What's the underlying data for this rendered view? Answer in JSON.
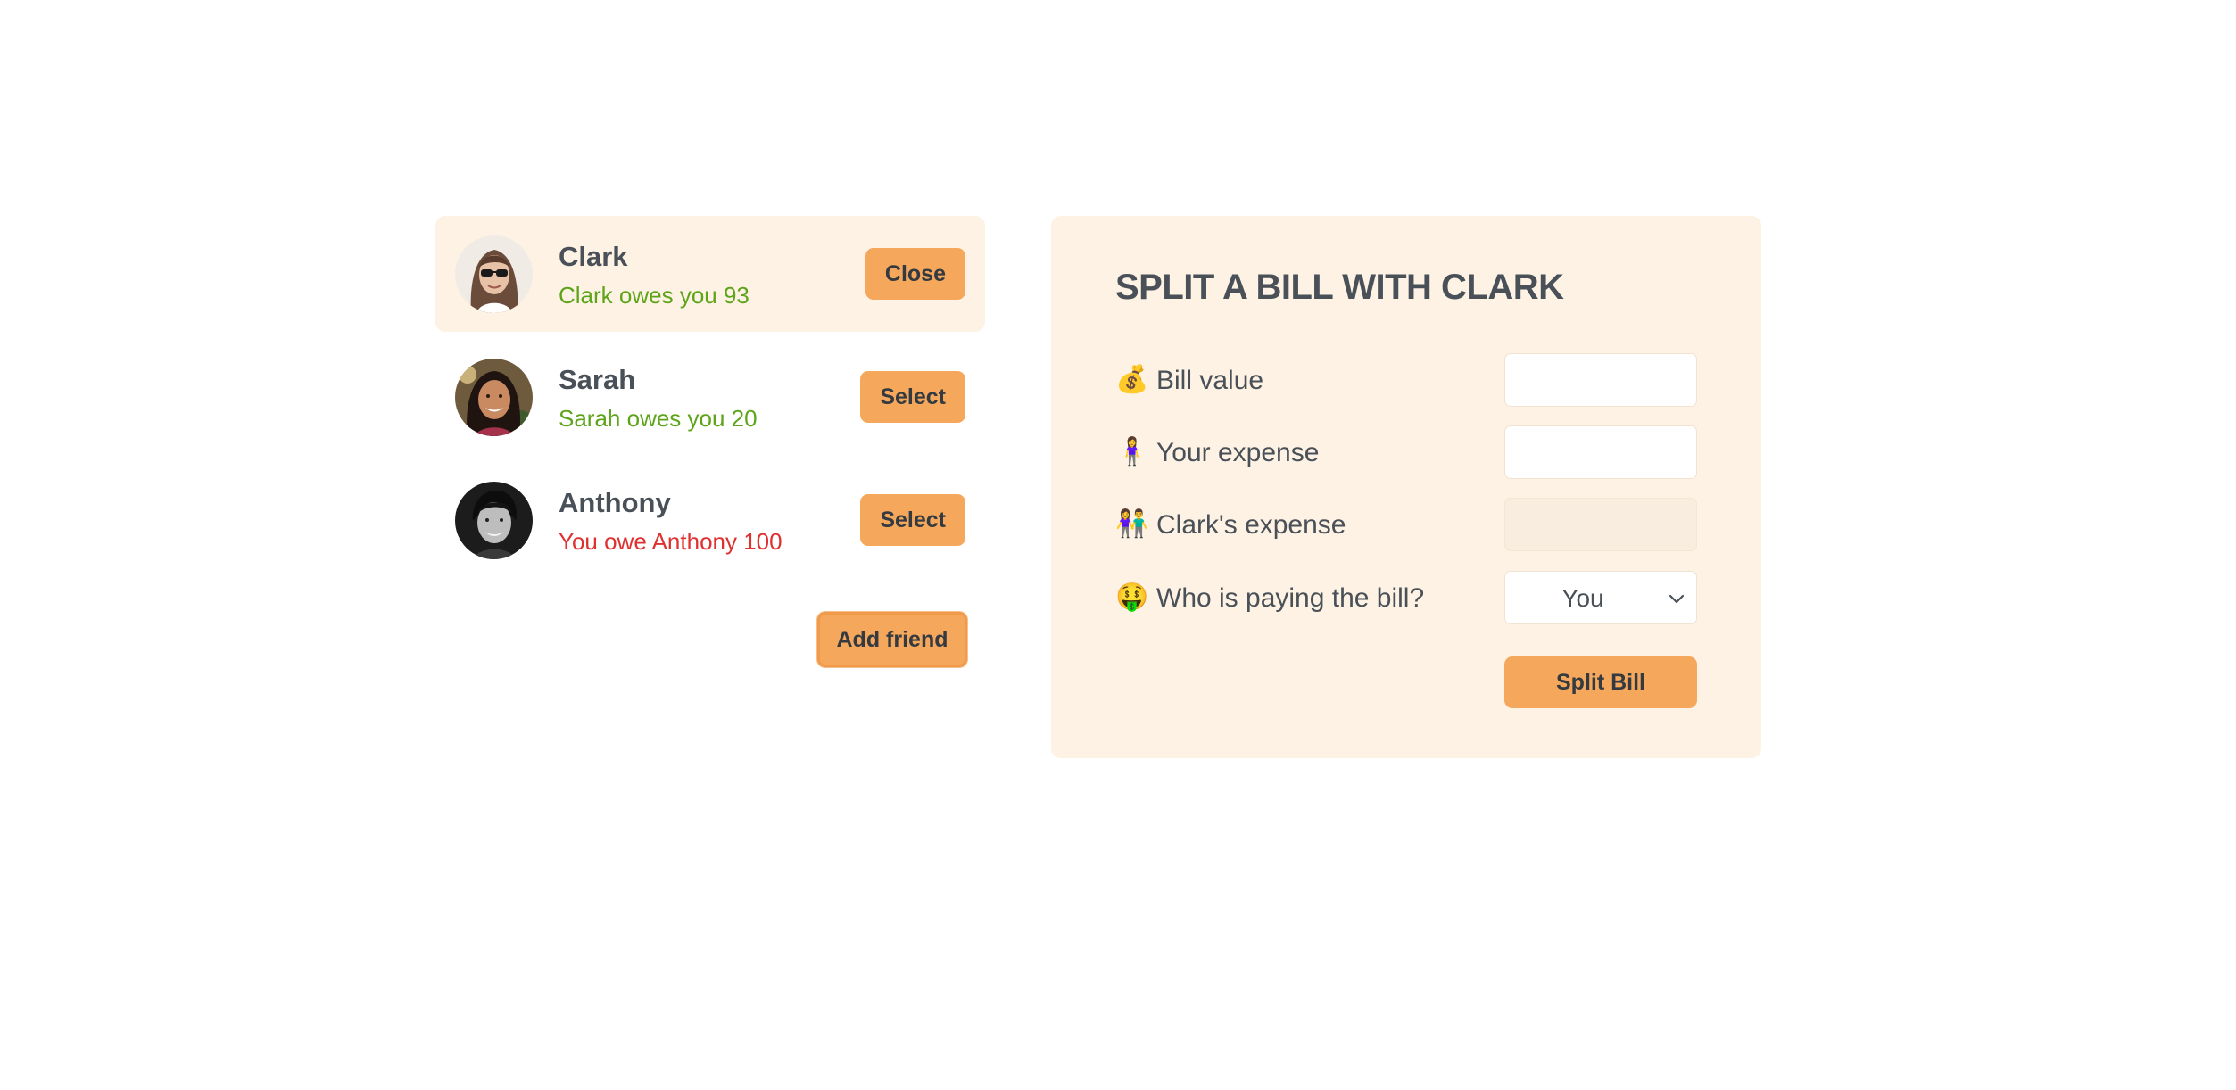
{
  "friends": [
    {
      "name": "Clark",
      "balance": "Clark owes you 93",
      "button": "Close",
      "selected": true,
      "status": "owes-you"
    },
    {
      "name": "Sarah",
      "balance": "Sarah owes you 20",
      "button": "Select",
      "selected": false,
      "status": "owes-you"
    },
    {
      "name": "Anthony",
      "balance": "You owe Anthony 100",
      "button": "Select",
      "selected": false,
      "status": "you-owe"
    }
  ],
  "add_friend_label": "Add friend",
  "split": {
    "title": "SPLIT A BILL WITH CLARK",
    "bill_value": {
      "emoji": "💰",
      "label": "Bill value",
      "value": ""
    },
    "your_expense": {
      "emoji": "🧍‍♀️",
      "label": "Your expense",
      "value": ""
    },
    "friend_expense": {
      "emoji": "👫",
      "label": "Clark's expense",
      "value": ""
    },
    "payer": {
      "emoji": "🤑",
      "label": "Who is paying the bill?",
      "selected": "You"
    },
    "submit_label": "Split Bill"
  },
  "colors": {
    "accent": "#f5a85c",
    "panel_bg": "#fdf2e4",
    "positive": "#5da419",
    "negative": "#e03131",
    "text": "#495057"
  }
}
